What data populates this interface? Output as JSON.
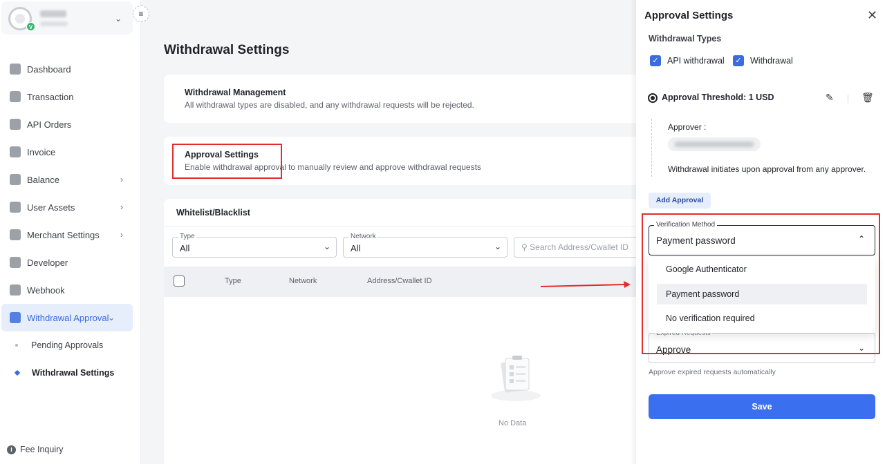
{
  "sidebar": {
    "items": [
      {
        "label": "Dashboard",
        "icon": "dashboard-icon"
      },
      {
        "label": "Transaction",
        "icon": "transaction-icon"
      },
      {
        "label": "API Orders",
        "icon": "api-orders-icon"
      },
      {
        "label": "Invoice",
        "icon": "invoice-icon"
      },
      {
        "label": "Balance",
        "icon": "balance-icon"
      },
      {
        "label": "User Assets",
        "icon": "user-assets-icon"
      },
      {
        "label": "Merchant Settings",
        "icon": "merchant-settings-icon"
      },
      {
        "label": "Developer",
        "icon": "developer-icon"
      },
      {
        "label": "Webhook",
        "icon": "webhook-icon"
      },
      {
        "label": "Withdrawal Approval",
        "icon": "withdrawal-approval-icon"
      }
    ],
    "sub_items": [
      "Pending Approvals",
      "Withdrawal Settings"
    ],
    "fee_inquiry": "Fee Inquiry",
    "badge": "V"
  },
  "main": {
    "title": "Withdrawal Settings",
    "management": {
      "title": "Withdrawal Management",
      "desc": "All withdrawal types are disabled, and any withdrawal requests will be rejected."
    },
    "approval": {
      "title": "Approval Settings",
      "desc": "Enable withdrawal approval to manually review and approve withdrawal requests"
    },
    "whitelist": {
      "title": "Whitelist/Blacklist",
      "type_label": "Type",
      "type_value": "All",
      "network_label": "Network",
      "network_value": "All",
      "search_placeholder": "Search Address/Cwallet ID",
      "columns": [
        "Type",
        "Network",
        "Address/Cwallet ID"
      ],
      "empty": "No Data"
    }
  },
  "panel": {
    "title": "Approval Settings",
    "withdrawal_types_label": "Withdrawal Types",
    "types": [
      "API withdrawal",
      "Withdrawal"
    ],
    "threshold": "Approval Threshold: 1 USD",
    "approver_label": "Approver :",
    "approval_note": "Withdrawal initiates upon approval from any approver.",
    "add_approval": "Add Approval",
    "verification": {
      "label": "Verification Method",
      "value": "Payment password",
      "options": [
        "Google Authenticator",
        "Payment password",
        "No verification required"
      ]
    },
    "expired": {
      "label": "Expired Requests",
      "value": "Approve",
      "hint": "Approve expired requests automatically"
    },
    "save": "Save"
  },
  "colors": {
    "accent": "#3a6ff0",
    "active_bg": "#e6edfb",
    "highlight": "#e52b2b"
  }
}
